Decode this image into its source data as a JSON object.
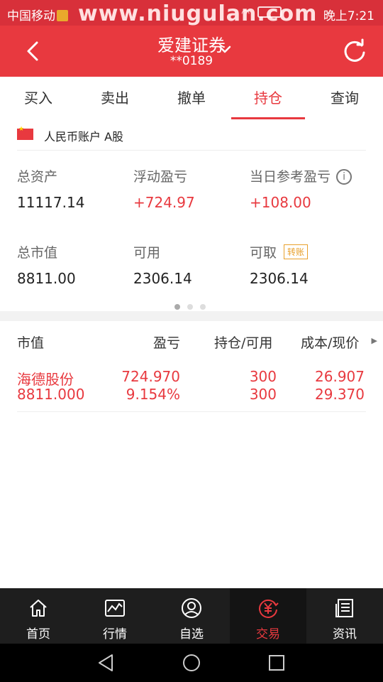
{
  "status_bar": {
    "carrier": "中国移动",
    "watermark": "www.niugulan.com",
    "time": "晚上7:21"
  },
  "header": {
    "title": "爱建证券",
    "account": "**0189",
    "back_icon": "back-arrow-icon",
    "dropdown_icon": "chevron-down-icon",
    "refresh_icon": "refresh-icon",
    "color": "#e8393f"
  },
  "tabs": [
    {
      "label": "买入"
    },
    {
      "label": "卖出"
    },
    {
      "label": "撤单"
    },
    {
      "label": "持仓",
      "active": true
    },
    {
      "label": "查询"
    }
  ],
  "account_type": {
    "label": "人民币账户 A股",
    "flag_icon": "china-flag-icon"
  },
  "stats": {
    "total_assets": {
      "label": "总资产",
      "value": "11117.14"
    },
    "floating_pnl": {
      "label": "浮动盈亏",
      "value": "+724.97"
    },
    "daily_pnl": {
      "label": "当日参考盈亏",
      "value": "+108.00"
    },
    "market_value": {
      "label": "总市值",
      "value": "8811.00"
    },
    "available": {
      "label": "可用",
      "value": "2306.14"
    },
    "withdrawable": {
      "label": "可取",
      "value": "2306.14",
      "badge": "转账"
    }
  },
  "pager": {
    "count": 3,
    "active": 0
  },
  "positions": {
    "headers": {
      "market_value": "市值",
      "pnl": "盈亏",
      "holding": "持仓/可用",
      "cost_price": "成本/现价"
    },
    "rows": [
      {
        "name": "海德股份",
        "market_value": "8811.000",
        "pnl": "724.970",
        "pnl_pct": "9.154%",
        "holding": "300",
        "available": "300",
        "cost": "26.907",
        "price": "29.370"
      }
    ]
  },
  "bottom_nav": [
    {
      "label": "首页",
      "icon": "home-icon"
    },
    {
      "label": "行情",
      "icon": "chart-icon"
    },
    {
      "label": "自选",
      "icon": "user-icon"
    },
    {
      "label": "交易",
      "icon": "yuan-icon",
      "active": true
    },
    {
      "label": "资讯",
      "icon": "news-icon"
    }
  ]
}
